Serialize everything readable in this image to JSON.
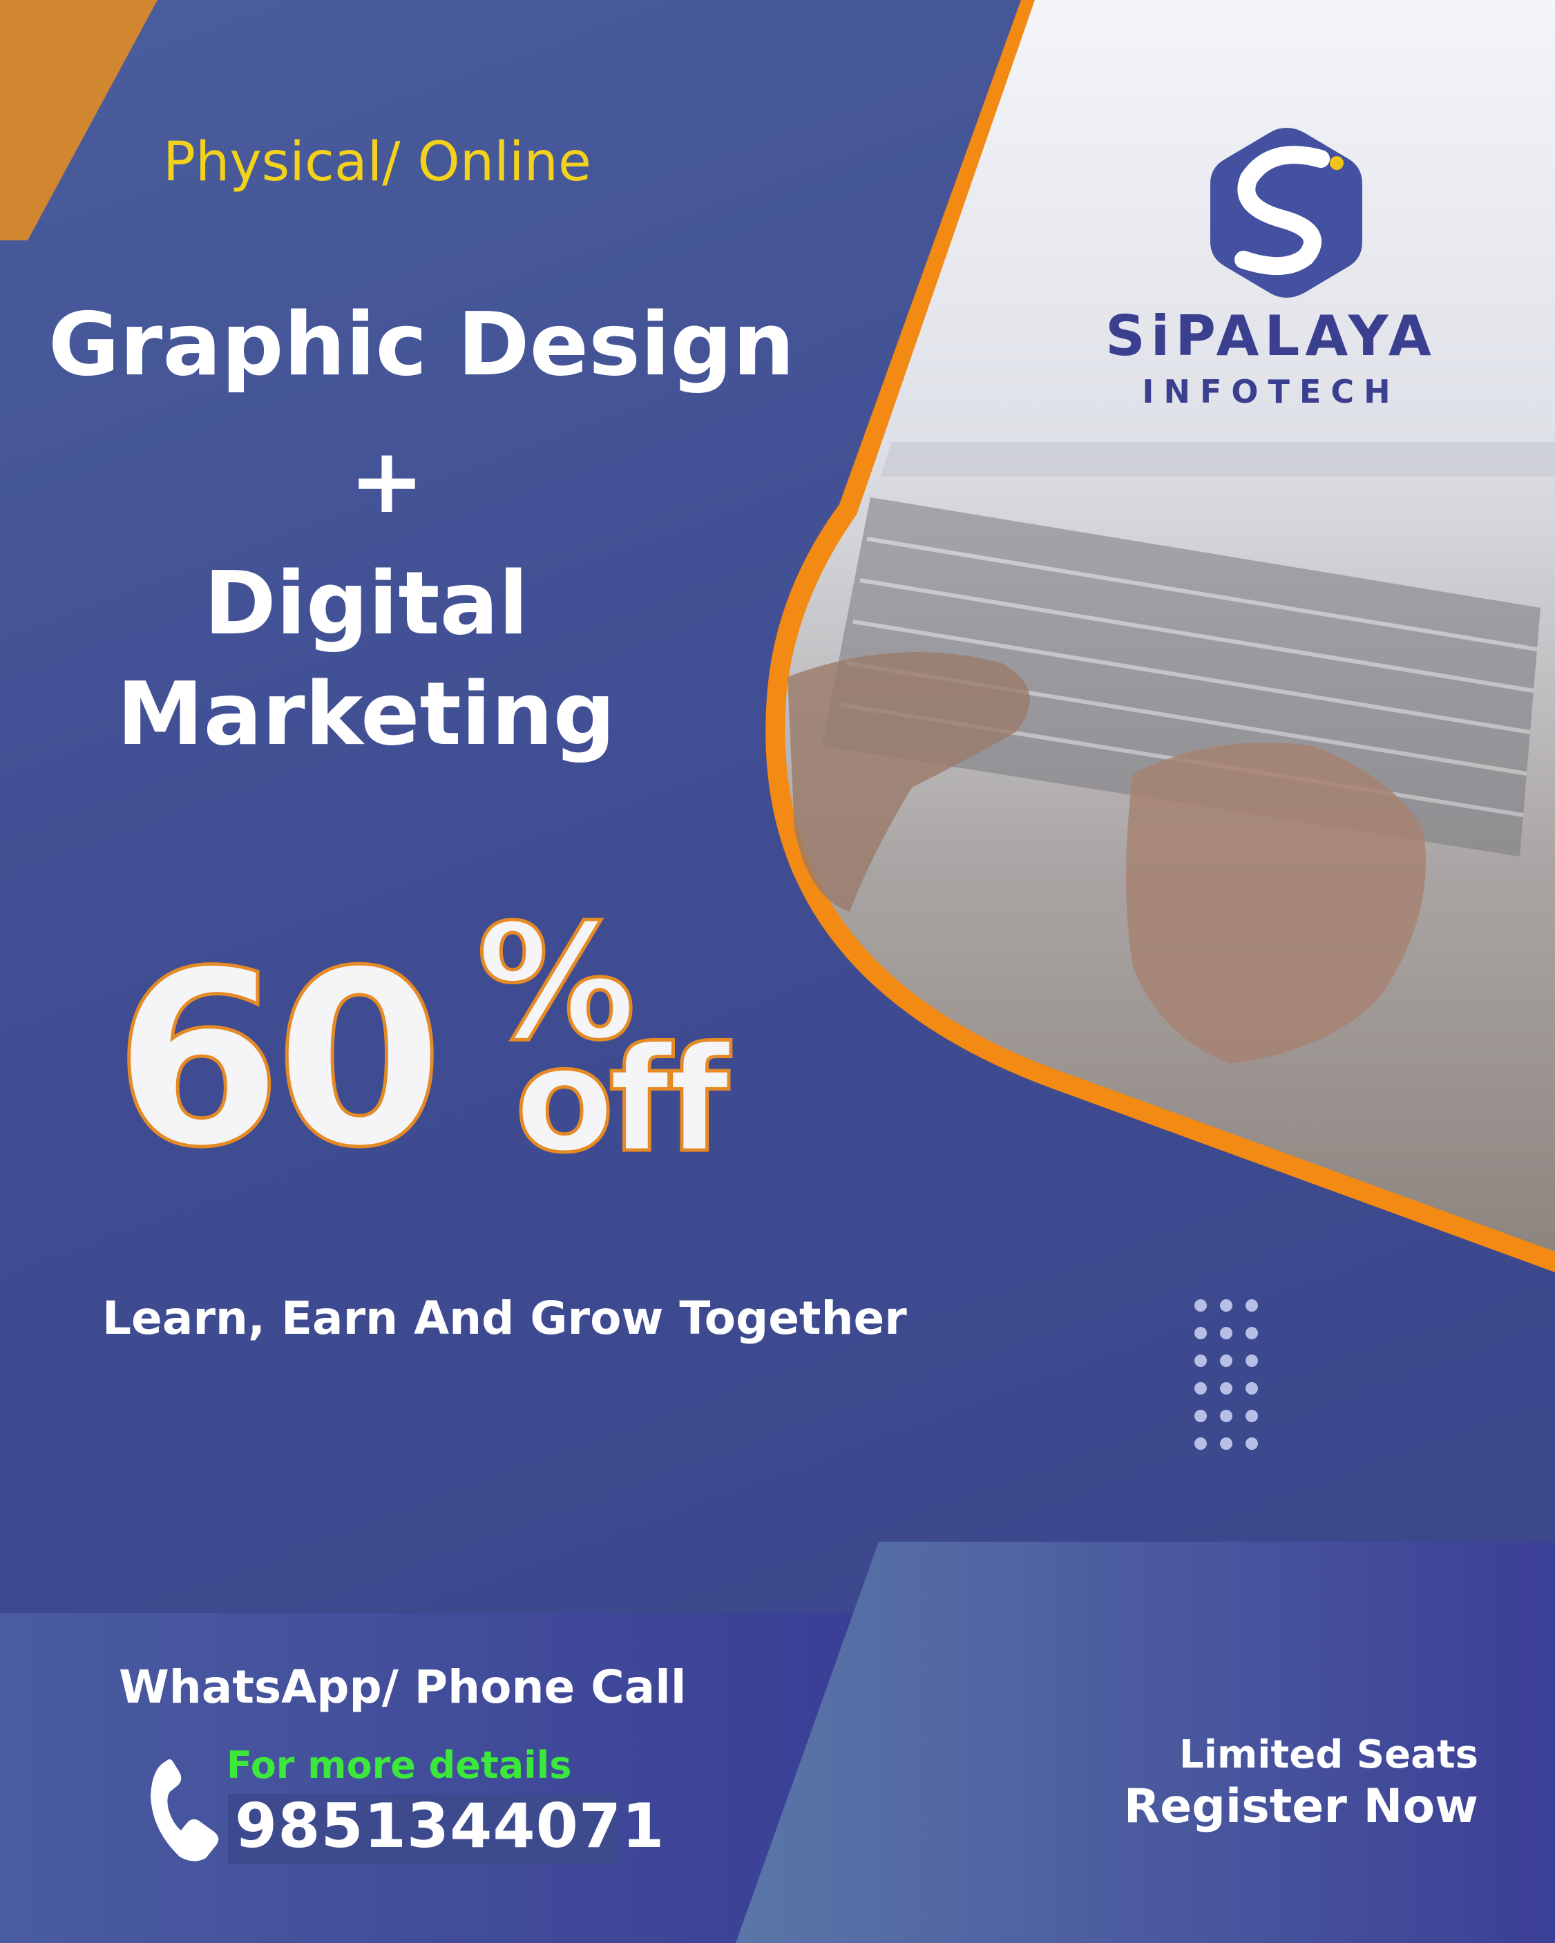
{
  "poster": {
    "mode": "Physical/ Online",
    "headline_line1": "Graphic Design",
    "headline_plus": "+",
    "headline_line2": "Digital",
    "headline_line3": "Marketing",
    "offer_number": "60",
    "offer_percent": "%",
    "offer_off": "off",
    "tagline": "Learn, Earn And Grow Together"
  },
  "brand": {
    "name": "SiPALAYA",
    "subtitle": "INFOTECH",
    "logo_icon": "s-hexagon-logo-icon"
  },
  "contact": {
    "channel_label": "WhatsApp/ Phone Call",
    "details_label": "For more details",
    "phone": "9851344071",
    "phone_icon": "phone-icon"
  },
  "cta": {
    "seats": "Limited Seats",
    "register": "Register Now"
  },
  "colors": {
    "background": "#3f4c92",
    "accent_orange": "#f28a13",
    "accent_yellow": "#f2d21b",
    "details_green": "#3be83b",
    "brand_blue": "#3b3f8f"
  }
}
